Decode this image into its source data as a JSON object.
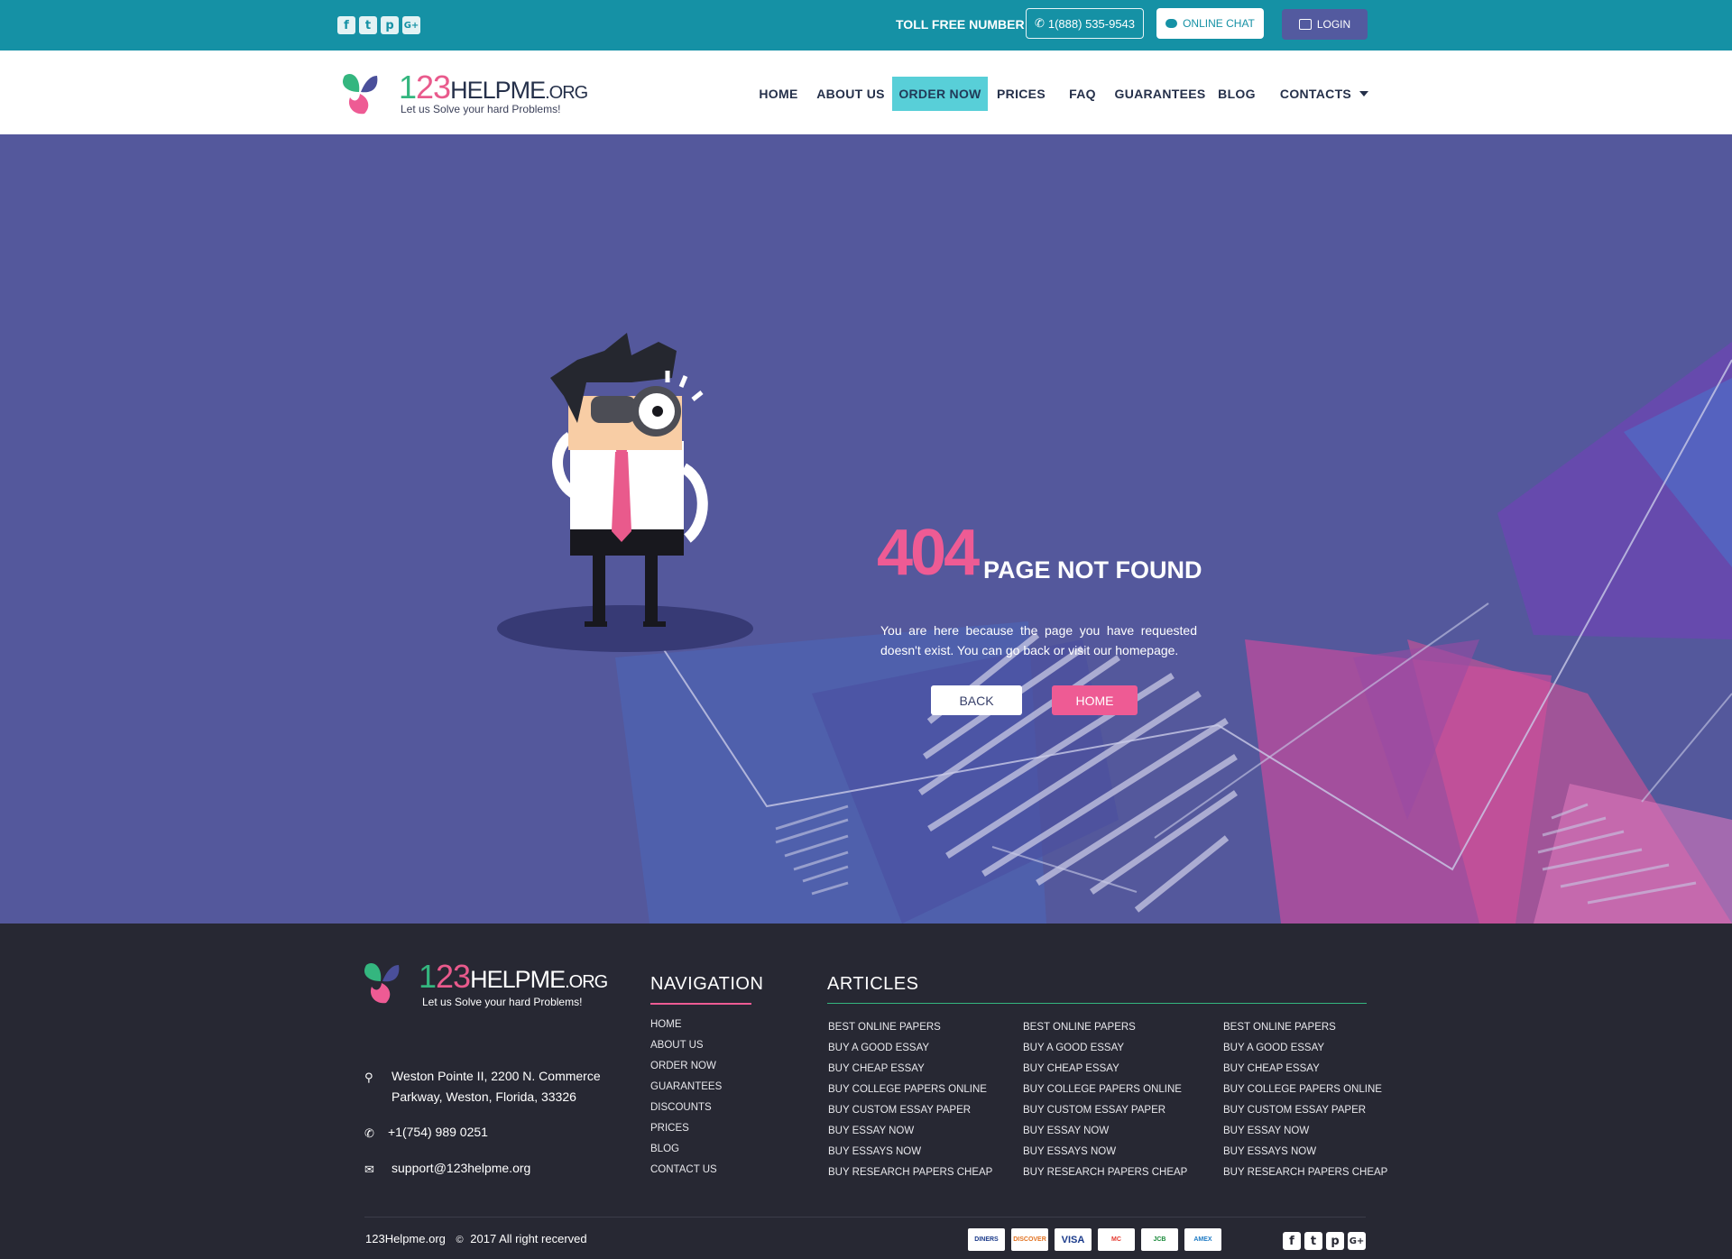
{
  "topbar": {
    "social": [
      "f",
      "t",
      "p",
      "G+"
    ],
    "toll_label": "TOLL FREE NUMBER",
    "phone": "1(888) 535-9543",
    "chat": "ONLINE CHAT",
    "login": "LOGIN"
  },
  "logo": {
    "n1": "1",
    "n2": "23",
    "n3": "HELPME",
    "n4": ".ORG",
    "tagline": "Let us Solve your hard Problems!"
  },
  "nav": [
    {
      "label": "HOME"
    },
    {
      "label": "ABOUT US"
    },
    {
      "label": "ORDER NOW"
    },
    {
      "label": "PRICES"
    },
    {
      "label": "FAQ"
    },
    {
      "label": "GUARANTEES"
    },
    {
      "label": "BLOG"
    },
    {
      "label": "CONTACTS"
    }
  ],
  "hero": {
    "code": "404",
    "title": "PAGE NOT FOUND",
    "text": "You are here because the page you have requested doesn't exist. You can go back or visit our homepage.",
    "back": "BACK",
    "home": "HOME"
  },
  "footer": {
    "address": [
      "Weston Pointe II, 2200 N. Commerce",
      "Parkway, Weston, Florida, 33326"
    ],
    "phone": "+1(754) 989 0251",
    "email": "support@123helpme.org",
    "nav_title": "NAVIGATION",
    "nav_items": [
      "HOME",
      "ABOUT US",
      "ORDER NOW",
      "GUARANTEES",
      "DISCOUNTS",
      "PRICES",
      "BLOG",
      "CONTACT US"
    ],
    "articles_title": "ARTICLES",
    "articles": [
      "BEST ONLINE PAPERS",
      "BUY A GOOD ESSAY",
      "BUY CHEAP ESSAY",
      "BUY COLLEGE PAPERS ONLINE",
      "BUY CUSTOM ESSAY PAPER",
      "BUY ESSAY NOW",
      "BUY ESSAYS NOW",
      "BUY RESEARCH PAPERS CHEAP"
    ],
    "copyright_site": "123Helpme.org",
    "copyright_sym": "©",
    "copyright_text": "2017 All right recerved",
    "payments": [
      "DINERS",
      "DISCOVER",
      "VISA",
      "MC",
      "JCB",
      "AMEX"
    ]
  },
  "colors": {
    "teal": "#1591a5",
    "hero_bg": "#54589c",
    "pink": "#ee5b94",
    "green": "#34b67f",
    "footer_bg": "#272833"
  }
}
